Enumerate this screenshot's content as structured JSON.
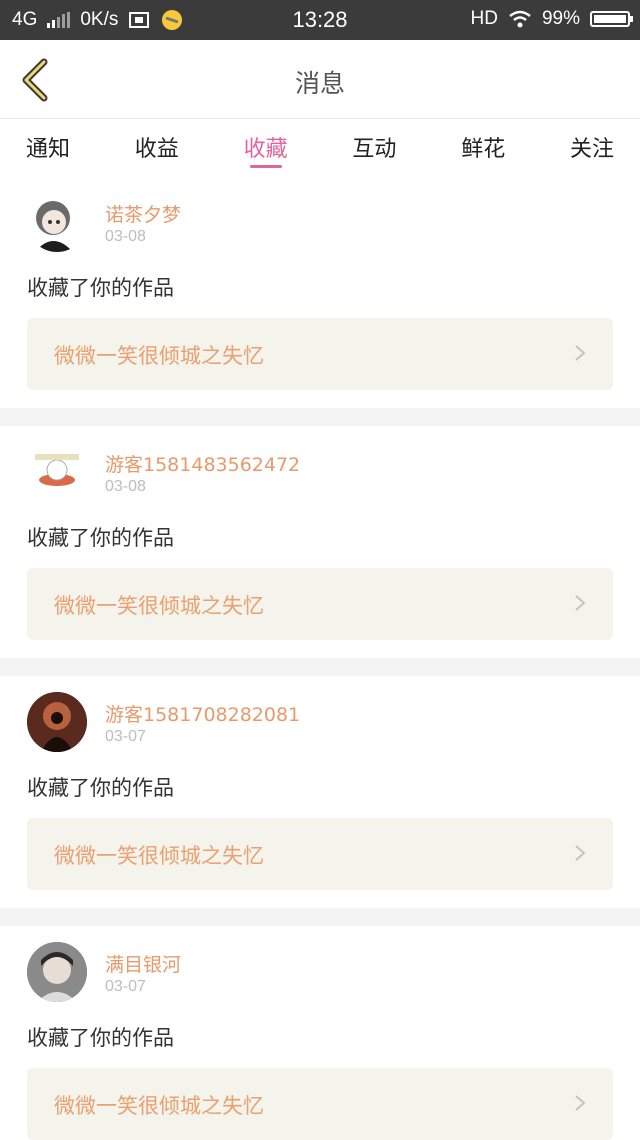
{
  "status_bar": {
    "network": "4G",
    "speed": "0K/s",
    "time": "13:28",
    "hd": "HD",
    "battery": "99%",
    "battery_level": 0.99
  },
  "header": {
    "title": "消息"
  },
  "tabs": [
    {
      "label": "通知"
    },
    {
      "label": "收益"
    },
    {
      "label": "收藏"
    },
    {
      "label": "互动"
    },
    {
      "label": "鲜花"
    },
    {
      "label": "关注"
    }
  ],
  "active_tab": "收藏",
  "notifications": [
    {
      "user": "诺茶夕梦",
      "date": "03-08",
      "action": "收藏了你的作品",
      "work": "微微一笑很倾城之失忆"
    },
    {
      "user": "游客1581483562472",
      "date": "03-08",
      "action": "收藏了你的作品",
      "work": "微微一笑很倾城之失忆"
    },
    {
      "user": "游客1581708282081",
      "date": "03-07",
      "action": "收藏了你的作品",
      "work": "微微一笑很倾城之失忆"
    },
    {
      "user": "满目银河",
      "date": "03-07",
      "action": "收藏了你的作品",
      "work": "微微一笑很倾城之失忆"
    }
  ],
  "colors": {
    "accent": "#e0659f",
    "username": "#e89a6c",
    "work_title": "#eaa06f",
    "work_bg": "#f4f3ec"
  }
}
